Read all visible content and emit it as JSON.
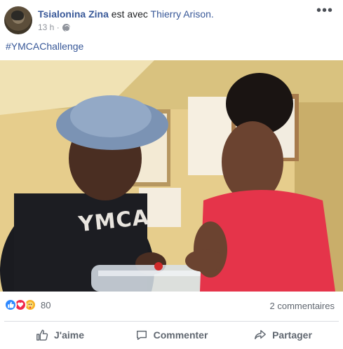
{
  "post": {
    "author": "Tsialonina Zina",
    "with_text": "est avec",
    "tagged": "Thierry Arison.",
    "time": "13 h ·",
    "privacy_icon": "globe-icon",
    "more_icon": "ellipsis-icon",
    "text": "#YMCAChallenge",
    "shirt_text": "YMCA"
  },
  "engagement": {
    "reaction_icons": [
      "like-icon",
      "love-icon",
      "care-icon"
    ],
    "reaction_count": "80",
    "comments_count": "2 commentaires"
  },
  "actions": {
    "like_label": "J'aime",
    "comment_label": "Commenter",
    "share_label": "Partager"
  },
  "colors": {
    "link": "#385898",
    "secondary_text": "#606770",
    "like_blue": "#2d88ff",
    "love_red": "#f0284a"
  }
}
